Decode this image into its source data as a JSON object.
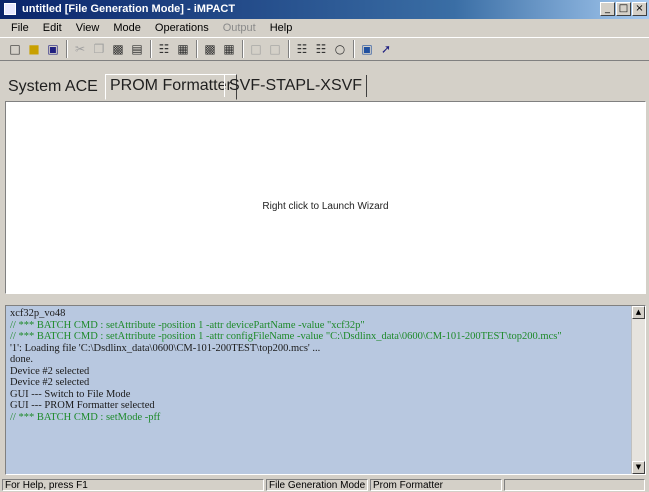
{
  "window": {
    "title": "untitled [File Generation Mode] - iMPACT",
    "buttons": {
      "minimize": "_",
      "maximize": "□",
      "close": "×"
    }
  },
  "menubar": {
    "items": [
      {
        "label": "File",
        "enabled": true
      },
      {
        "label": "Edit",
        "enabled": true
      },
      {
        "label": "View",
        "enabled": true
      },
      {
        "label": "Mode",
        "enabled": true
      },
      {
        "label": "Operations",
        "enabled": true
      },
      {
        "label": "Output",
        "enabled": false
      },
      {
        "label": "Help",
        "enabled": true
      }
    ]
  },
  "toolbar": {
    "icons": [
      "new-icon",
      "open-icon",
      "save-icon",
      "cut-icon",
      "copy-icon",
      "paste-icon",
      "print-icon",
      "chain-icon",
      "debug-icon",
      "step-icon",
      "device-icon",
      "grid-icon",
      "config-icon",
      "fit-icon",
      "zoom-icon",
      "refresh-icon",
      "program-icon",
      "help-icon"
    ]
  },
  "tabs": [
    {
      "label": "System ACE",
      "active": false
    },
    {
      "label": "PROM Formatter",
      "active": true
    },
    {
      "label": "SVF-STAPL-XSVF",
      "active": false
    }
  ],
  "main": {
    "hint": "Right click to Launch Wizard"
  },
  "console": {
    "lines": [
      {
        "text": "xcf32p_vo48",
        "type": "info"
      },
      {
        "text": "// *** BATCH CMD : setAttribute -position 1 -attr devicePartName -value \"xcf32p\"",
        "type": "cmd"
      },
      {
        "text": "// *** BATCH CMD : setAttribute -position 1 -attr configFileName -value \"C:\\Dsdlinx_data\\0600\\CM-101-200TEST\\top200.mcs\"",
        "type": "cmd"
      },
      {
        "text": "'1': Loading file 'C:\\Dsdlinx_data\\0600\\CM-101-200TEST\\top200.mcs' ...",
        "type": "info"
      },
      {
        "text": "done.",
        "type": "info"
      },
      {
        "text": "Device #2 selected",
        "type": "info"
      },
      {
        "text": "Device #2 selected",
        "type": "info"
      },
      {
        "text": "GUI --- Switch to File Mode",
        "type": "info"
      },
      {
        "text": "GUI --- PROM Formatter selected",
        "type": "info"
      },
      {
        "text": "// *** BATCH CMD : setMode -pff",
        "type": "cmd"
      }
    ]
  },
  "statusbar": {
    "help": "For Help, press F1",
    "mode": "File Generation Mode",
    "tool": "Prom Formatter"
  },
  "colors": {
    "titlebar_start": "#0a246a",
    "console_bg": "#b8c8e0",
    "batch_cmd_text": "#1e8a2a"
  }
}
